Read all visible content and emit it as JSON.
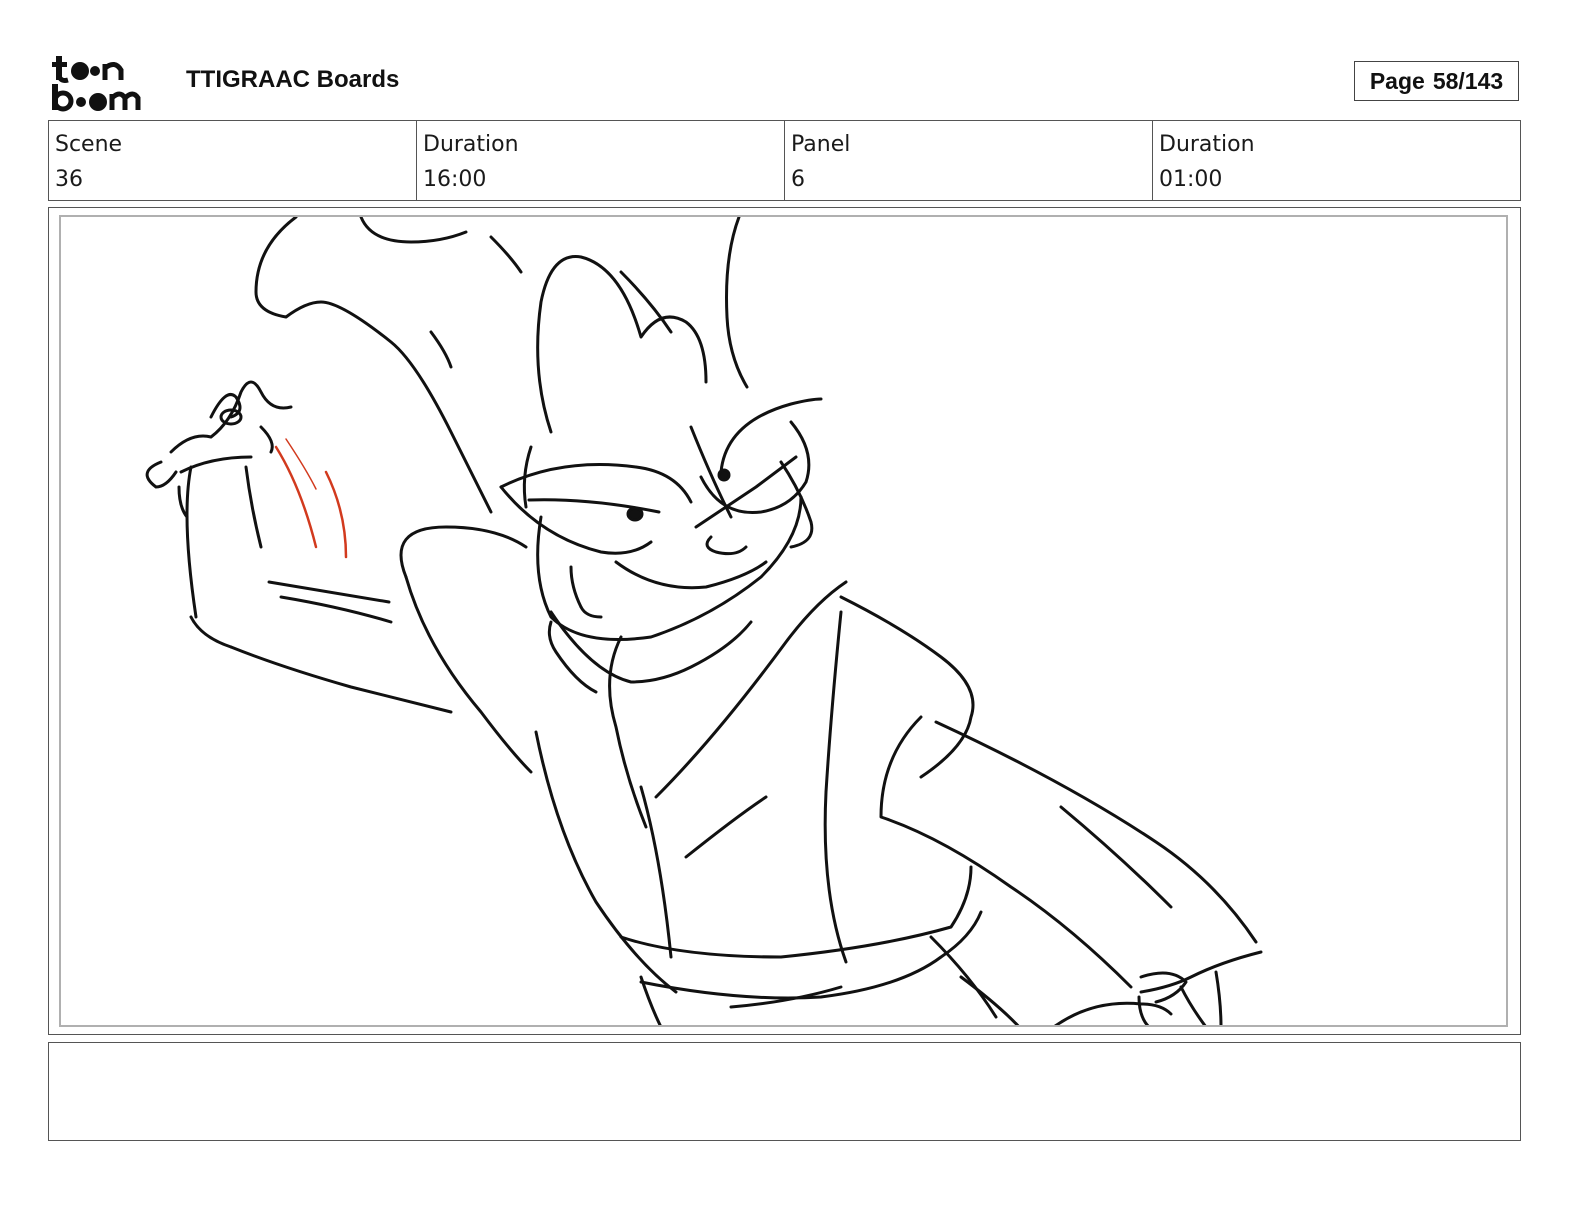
{
  "header": {
    "logo_text": "toon boom",
    "document_title": "TTIGRAAC Boards",
    "page_label": "Page",
    "page_number": "58/143"
  },
  "info": {
    "scene_label": "Scene",
    "scene_value": "36",
    "scene_duration_label": "Duration",
    "scene_duration_value": "16:00",
    "panel_label": "Panel",
    "panel_value": "6",
    "panel_duration_label": "Duration",
    "panel_duration_value": "01:00"
  },
  "panel": {
    "sketch_icon": "character-sketch",
    "stroke_color": "#111111",
    "accent_stroke_color": "#d23a1e"
  },
  "notes": {
    "text": ""
  }
}
